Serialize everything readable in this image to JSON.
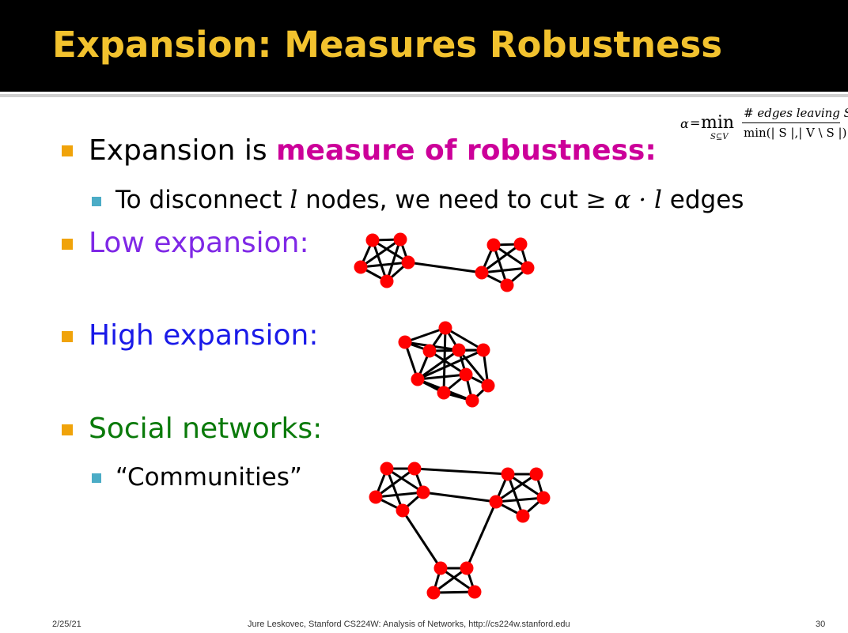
{
  "slide": {
    "title": "Expansion: Measures Robustness",
    "formula": {
      "lhs": "α",
      "eq": "=",
      "min": "min",
      "subscript": "S⊆V",
      "numerator": "# edges leaving S",
      "denominator": "min(| S |,| V \\ S |)"
    },
    "bullets": {
      "b1_prefix": "Expansion is ",
      "b1_highlight": "measure of robustness:",
      "b1_sub_prefix": "To disconnect ",
      "b1_sub_var": "l",
      "b1_sub_middle": " nodes, we need to cut ",
      "b1_sub_math": "≥ α · l",
      "b1_sub_suffix": " edges",
      "b2": "Low expansion:",
      "b3": "High expansion:",
      "b4": "Social networks:",
      "b4_sub": "“Communities”"
    },
    "footer": {
      "date": "2/25/21",
      "credit": "Jure Leskovec, Stanford CS224W: Analysis of Networks, http://cs224w.stanford.edu",
      "page": "30"
    },
    "colors": {
      "title": "#f2c22e",
      "highlight": "#cc0099",
      "low": "#7f28e6",
      "high": "#1a1ae8",
      "social": "#0a7a0a",
      "node": "#ff0000"
    }
  }
}
